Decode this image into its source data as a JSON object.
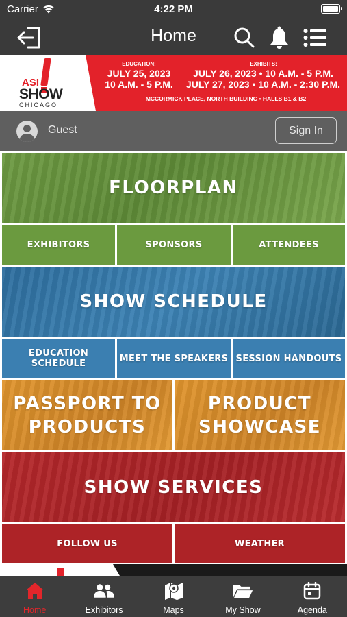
{
  "status_bar": {
    "carrier": "Carrier",
    "time": "4:22 PM"
  },
  "nav": {
    "title": "Home"
  },
  "banner": {
    "logo_asi": "ASI",
    "logo_show": "SHOW",
    "logo_city": "CHICAGO",
    "education_label": "EDUCATION:",
    "education_line1": "JULY 25, 2023",
    "education_line2": "10 A.M. - 5 P.M.",
    "exhibits_label": "EXHIBITS:",
    "exhibits_line1": "JULY 26, 2023 • 10 A.M. - 5 P.M.",
    "exhibits_line2": "JULY 27, 2023 • 10 A.M. - 2:30 P.M.",
    "venue": "MCCORMICK PLACE, NORTH BUILDING • HALLS B1 & B2"
  },
  "guest": {
    "name": "Guest",
    "sign_in_label": "Sign In"
  },
  "tiles": {
    "floorplan": "FLOORPLAN",
    "exhibitors": "EXHIBITORS",
    "sponsors": "SPONSORS",
    "attendees": "ATTENDEES",
    "show_schedule": "SHOW SCHEDULE",
    "education_schedule": "EDUCATION SCHEDULE",
    "meet_the_speakers": "MEET THE SPEAKERS",
    "session_handouts": "SESSION HANDOUTS",
    "passport_line1": "PASSPORT TO",
    "passport_line2": "PRODUCTS",
    "product_line1": "PRODUCT",
    "product_line2": "SHOWCASE",
    "show_services": "SHOW SERVICES",
    "follow_us": "FOLLOW US",
    "weather": "WEATHER"
  },
  "tabbar": {
    "items": [
      {
        "label": "Home",
        "icon": "home-icon",
        "active": true
      },
      {
        "label": "Exhibitors",
        "icon": "people-icon",
        "active": false
      },
      {
        "label": "Maps",
        "icon": "map-icon",
        "active": false
      },
      {
        "label": "My Show",
        "icon": "folder-icon",
        "active": false
      },
      {
        "label": "Agenda",
        "icon": "calendar-icon",
        "active": false
      }
    ]
  },
  "colors": {
    "accent_red": "#e2262b",
    "tile_green": "#6b9a3f",
    "tile_blue": "#3b7fb1",
    "tile_orange": "#d98c2b",
    "tile_red": "#ad2327",
    "chrome_dark": "#3a3a3a"
  }
}
